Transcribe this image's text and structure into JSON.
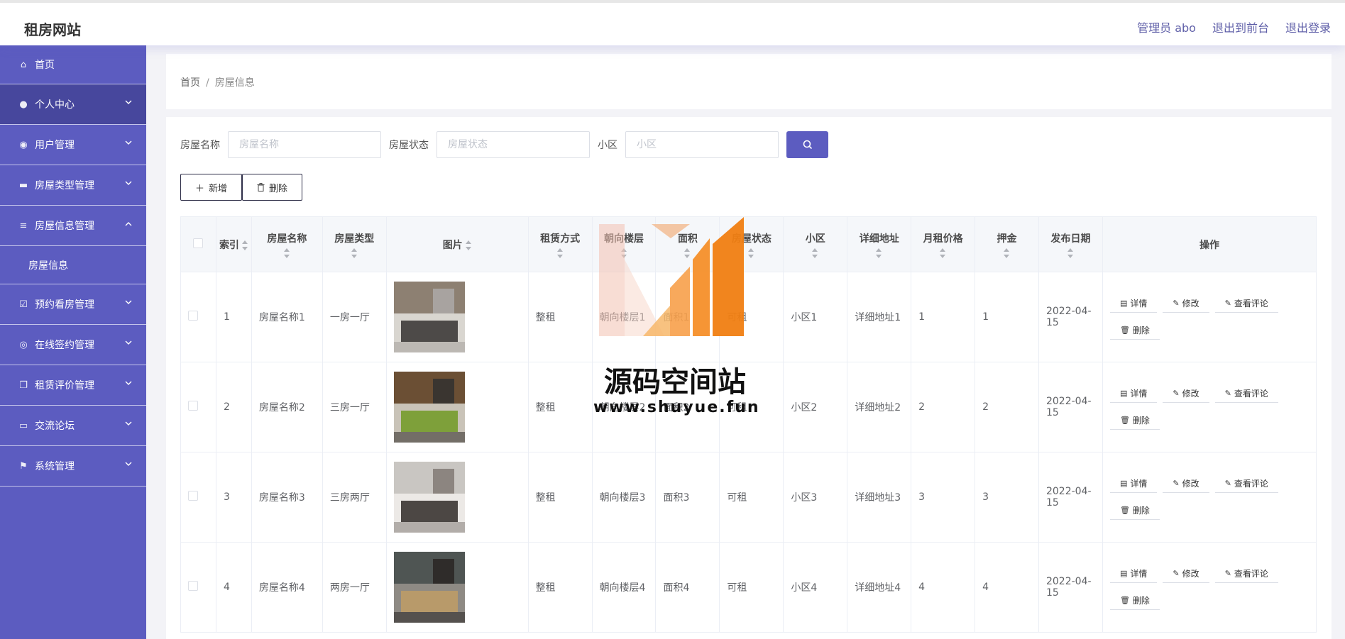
{
  "app": {
    "title": "租房网站"
  },
  "header_links": [
    "管理员 abo",
    "退出到前台",
    "退出登录"
  ],
  "sidebar": {
    "items": [
      {
        "label": "首页",
        "icon": "home-icon",
        "has_chevron": false,
        "active": false
      },
      {
        "label": "个人中心",
        "icon": "user-icon",
        "has_chevron": true,
        "active": true
      },
      {
        "label": "用户管理",
        "icon": "users-icon",
        "has_chevron": true,
        "active": false
      },
      {
        "label": "房屋类型管理",
        "icon": "category-icon",
        "has_chevron": true,
        "active": false
      },
      {
        "label": "房屋信息管理",
        "icon": "list-icon",
        "has_chevron": true,
        "expanded": true,
        "active": false
      },
      {
        "label": "房屋信息",
        "sub": true
      },
      {
        "label": "预约看房管理",
        "icon": "calendar-check-icon",
        "has_chevron": true,
        "active": false
      },
      {
        "label": "在线签约管理",
        "icon": "compass-icon",
        "has_chevron": true,
        "active": false
      },
      {
        "label": "租赁评价管理",
        "icon": "copy-icon",
        "has_chevron": true,
        "active": false
      },
      {
        "label": "交流论坛",
        "icon": "podium-icon",
        "has_chevron": true,
        "active": false
      },
      {
        "label": "系统管理",
        "icon": "flag-icon",
        "has_chevron": true,
        "active": false
      }
    ]
  },
  "breadcrumb": {
    "home": "首页",
    "separator": "/",
    "current": "房屋信息"
  },
  "search": {
    "fields": [
      {
        "label": "房屋名称",
        "placeholder": "房屋名称"
      },
      {
        "label": "房屋状态",
        "placeholder": "房屋状态"
      },
      {
        "label": "小区",
        "placeholder": "小区"
      }
    ]
  },
  "actions": {
    "add": "新增",
    "delete": "删除"
  },
  "table": {
    "columns": [
      "索引",
      "房屋名称",
      "房屋类型",
      "图片",
      "租赁方式",
      "朝向楼层",
      "面积",
      "房屋状态",
      "小区",
      "详细地址",
      "月租价格",
      "押金",
      "发布日期",
      "操作"
    ],
    "row_actions": [
      "详情",
      "修改",
      "查看评论",
      "删除"
    ],
    "rows": [
      {
        "index": "1",
        "name": "房屋名称1",
        "type": "一房一厅",
        "mode": "整租",
        "floor": "朝向楼层1",
        "area": "面积1",
        "status": "可租",
        "community": "小区1",
        "address": "详细地址1",
        "rent": "1",
        "deposit": "1",
        "date": "2022-04-15"
      },
      {
        "index": "2",
        "name": "房屋名称2",
        "type": "三房一厅",
        "mode": "整租",
        "floor": "朝向楼层2",
        "area": "面积2",
        "status": "可租",
        "community": "小区2",
        "address": "详细地址2",
        "rent": "2",
        "deposit": "2",
        "date": "2022-04-15"
      },
      {
        "index": "3",
        "name": "房屋名称3",
        "type": "三房两厅",
        "mode": "整租",
        "floor": "朝向楼层3",
        "area": "面积3",
        "status": "可租",
        "community": "小区3",
        "address": "详细地址3",
        "rent": "3",
        "deposit": "3",
        "date": "2022-04-15"
      },
      {
        "index": "4",
        "name": "房屋名称4",
        "type": "两房一厅",
        "mode": "整租",
        "floor": "朝向楼层4",
        "area": "面积4",
        "status": "可租",
        "community": "小区4",
        "address": "详细地址4",
        "rent": "4",
        "deposit": "4",
        "date": "2022-04-15"
      }
    ]
  },
  "watermark": {
    "line1": "源码空间站",
    "line2": "www.shuyue.fun"
  },
  "colors": {
    "accent": "#5c5cc0",
    "active_nav": "#47479d",
    "link": "#5f5fa8"
  }
}
